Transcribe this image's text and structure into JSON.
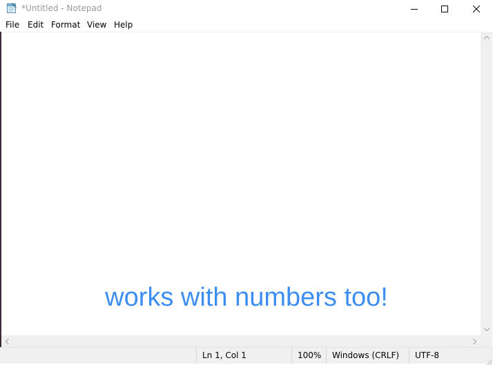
{
  "window": {
    "title": "*Untitled - Notepad"
  },
  "menu": {
    "file": "File",
    "edit": "Edit",
    "format": "Format",
    "view": "View",
    "help": "Help"
  },
  "editor": {
    "content": ""
  },
  "status": {
    "position": "Ln 1, Col 1",
    "zoom": "100%",
    "line_ending": "Windows (CRLF)",
    "encoding": "UTF-8"
  },
  "overlay": {
    "caption": "works with numbers too!",
    "color": "#3d8ef0"
  },
  "icons": {
    "app": "notepad-icon",
    "minimize": "minimize-icon",
    "maximize": "maximize-icon",
    "close": "close-icon"
  }
}
